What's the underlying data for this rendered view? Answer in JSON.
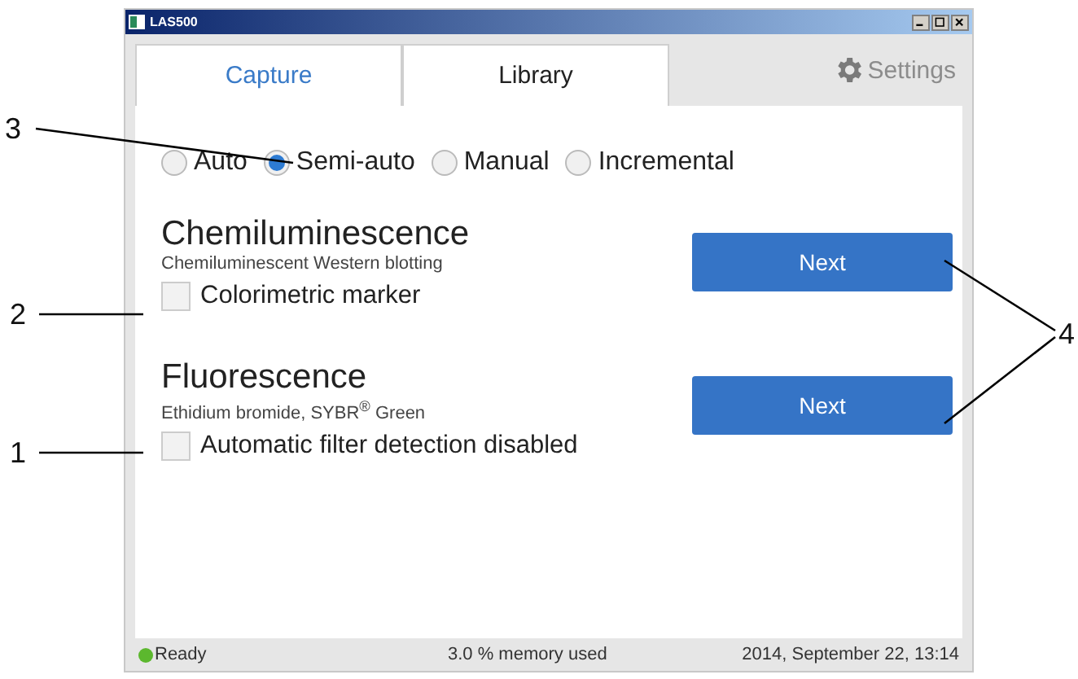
{
  "window": {
    "title": "LAS500"
  },
  "tabs": [
    {
      "label": "Capture",
      "selected": true
    },
    {
      "label": "Library",
      "selected": false
    }
  ],
  "settings": {
    "label": "Settings"
  },
  "modes": [
    {
      "label": "Auto",
      "selected": false
    },
    {
      "label": "Semi-auto",
      "selected": true
    },
    {
      "label": "Manual",
      "selected": false
    },
    {
      "label": "Incremental",
      "selected": false
    }
  ],
  "sections": [
    {
      "title": "Chemiluminescence",
      "subtitle": "Chemiluminescent Western blotting",
      "option": {
        "label": "Colorimetric marker",
        "checked": false
      },
      "button": "Next"
    },
    {
      "title": "Fluorescence",
      "subtitle": "Ethidium bromide, SYBR$^{®}$ Green",
      "option": {
        "label": "Automatic filter detection disabled",
        "checked": false
      },
      "button": "Next"
    }
  ],
  "status_bar": {
    "state": "Ready",
    "memory": "3.0 % memory used",
    "datetime": "2014, September 22, 13:14"
  },
  "callouts": [
    {
      "number": "3"
    },
    {
      "number": "2"
    },
    {
      "number": "1"
    },
    {
      "number": "4"
    }
  ]
}
